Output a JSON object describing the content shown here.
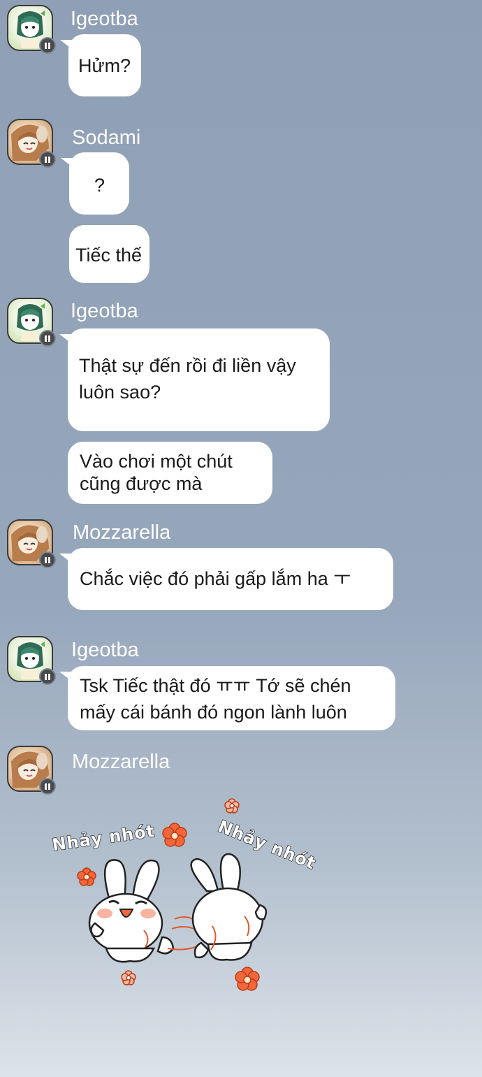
{
  "chat": {
    "messages": [
      {
        "sender": "Igeotba",
        "avatar": "girl-green-hair-avatar",
        "bubbles": [
          "Hửm?"
        ]
      },
      {
        "sender": "Sodami",
        "avatar": "girl-brown-hair-avatar",
        "bubbles": [
          "?",
          "Tiếc thế"
        ]
      },
      {
        "sender": "Igeotba",
        "avatar": "girl-green-hair-avatar",
        "bubbles": [
          "Thật sự đến rồi đi liền vậy\nluôn sao?",
          "Vào chơi một chút\ncũng được mà"
        ]
      },
      {
        "sender": "Mozzarella",
        "avatar": "girl-brown-hair-avatar",
        "bubbles": [
          "Chắc việc đó phải gấp lắm ha ㅜ"
        ]
      },
      {
        "sender": "Igeotba",
        "avatar": "girl-green-hair-avatar",
        "bubbles": [
          "Tsk Tiếc thật đó ㅠㅠ Tớ sẽ chén\nmấy cái bánh đó ngon lành luôn"
        ]
      },
      {
        "sender": "Mozzarella",
        "avatar": "girl-brown-hair-avatar",
        "sticker": {
          "text_left": "Nhảy nhót",
          "text_right": "Nhảy nhót",
          "icon": "dancing-bunnies-sticker"
        }
      }
    ]
  },
  "colors": {
    "background_top": "#8f9fb5",
    "background_bottom": "#dde3ea",
    "bubble": "#ffffff",
    "name_text": "#ffffff",
    "flower": "#f2663a"
  }
}
